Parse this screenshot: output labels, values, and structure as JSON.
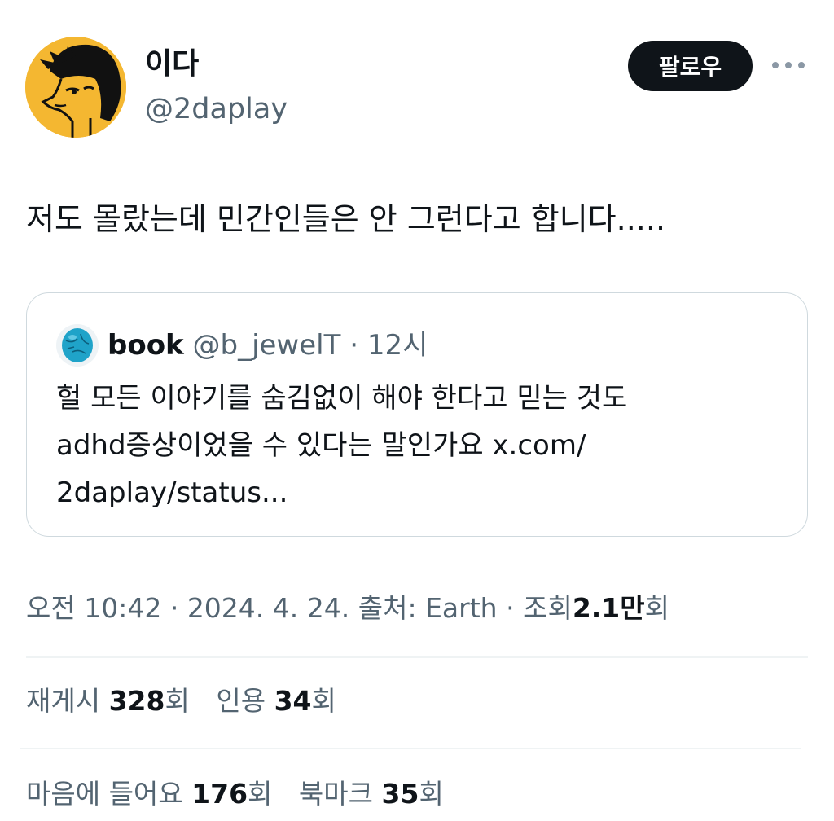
{
  "author": {
    "display_name": "이다",
    "handle": "@2daplay",
    "follow_label": "팔로우",
    "avatar_icon": "cartoon-face-avatar-icon",
    "more_icon": "more-horizontal-icon"
  },
  "tweet": {
    "text": "저도 몰랐는데 민간인들은 안 그런다고 합니다....."
  },
  "quote": {
    "avatar_icon": "turquoise-stone-avatar-icon",
    "name": "book",
    "handle": "@b_jewelT",
    "separator": "·",
    "time": "12시",
    "lines": [
      "헐 모든 이야기를 숨김없이 해야 한다고 믿는 것도",
      "adhd증상이었을 수 있다는 말인가요 x.com/",
      "2daplay/status..."
    ]
  },
  "meta": {
    "time": "오전 10:42",
    "sep1": "·",
    "date": "2024. 4. 24.",
    "source_label": "출처:",
    "source": "Earth",
    "sep2": "·",
    "views_label": "조회",
    "views_number": "2.1만",
    "views_unit": "회"
  },
  "stats": {
    "retweets": {
      "label": "재게시",
      "value": "328",
      "unit": "회"
    },
    "quotes": {
      "label": "인용",
      "value": "34",
      "unit": "회"
    },
    "likes": {
      "label": "마음에 들어요",
      "value": "176",
      "unit": "회"
    },
    "bookmarks": {
      "label": "북마크",
      "value": "35",
      "unit": "회"
    }
  },
  "colors": {
    "text_primary": "#0f1419",
    "text_secondary": "#536471",
    "border": "#cfd9de",
    "divider": "#eff3f4",
    "avatar_bg": "#f4b731",
    "follow_bg": "#0f1419"
  }
}
